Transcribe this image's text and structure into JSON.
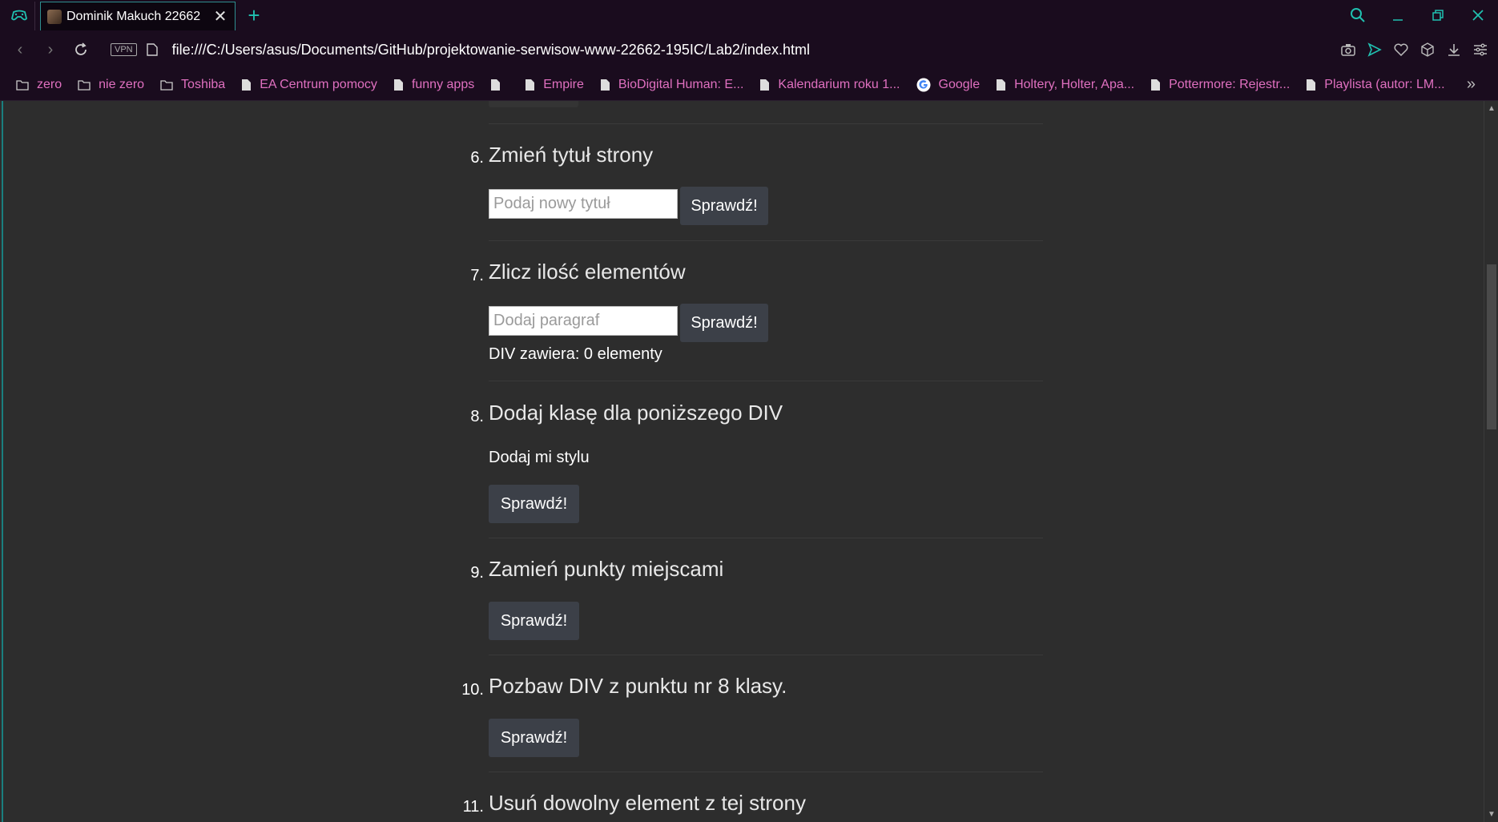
{
  "browser": {
    "tab": {
      "title": "Dominik Makuch 22662"
    },
    "url": "file:///C:/Users/asus/Documents/GitHub/projektowanie-serwisow-www-22662-195IC/Lab2/index.html",
    "vpn_label": "VPN",
    "bookmarks": [
      {
        "label": "zero",
        "icon": "folder-icon"
      },
      {
        "label": "nie zero",
        "icon": "folder-icon"
      },
      {
        "label": "Toshiba",
        "icon": "folder-icon"
      },
      {
        "label": "EA Centrum pomocy",
        "icon": "page-icon"
      },
      {
        "label": "funny apps",
        "icon": "page-icon"
      },
      {
        "label": "",
        "icon": "page-icon"
      },
      {
        "label": "Empire",
        "icon": "page-icon"
      },
      {
        "label": "BioDigital Human: E...",
        "icon": "page-icon"
      },
      {
        "label": "Kalendarium roku 1...",
        "icon": "page-icon"
      },
      {
        "label": "Google",
        "icon": "google-icon"
      },
      {
        "label": "Holtery, Holter, Apa...",
        "icon": "page-icon"
      },
      {
        "label": "Pottermore: Rejestr...",
        "icon": "page-icon"
      },
      {
        "label": "Playlista (autor: LM...",
        "icon": "page-icon"
      }
    ],
    "colors": {
      "chrome_bg": "#1a0c1e",
      "accent": "#20c0b0",
      "bookmark_text": "#e070c0",
      "page_bg": "#2d2d2d"
    }
  },
  "page": {
    "items": [
      {
        "num": "6.",
        "title": "Zmień tytuł strony",
        "input_placeholder": "Podaj nowy tytuł",
        "button": "Sprawdź!"
      },
      {
        "num": "7.",
        "title": "Zlicz ilość elementów",
        "input_placeholder": "Dodaj paragraf",
        "button": "Sprawdź!",
        "status": "DIV zawiera: 0 elementy"
      },
      {
        "num": "8.",
        "title": "Dodaj klasę dla poniższego DIV",
        "text": "Dodaj mi stylu",
        "button": "Sprawdź!"
      },
      {
        "num": "9.",
        "title": "Zamień punkty miejscami",
        "button": "Sprawdź!"
      },
      {
        "num": "10.",
        "title": "Pozbaw DIV z punktu nr 8 klasy.",
        "button": "Sprawdź!"
      },
      {
        "num": "11.",
        "title": "Usuń dowolny element z tej strony"
      }
    ]
  }
}
